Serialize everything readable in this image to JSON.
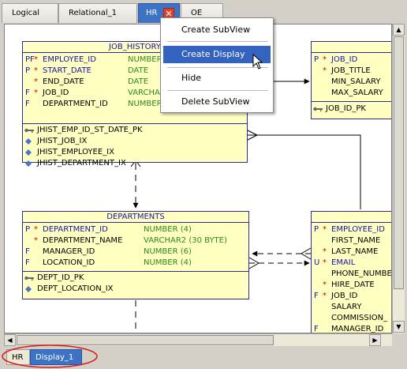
{
  "tabs": [
    {
      "label": "Logical"
    },
    {
      "label": "Relational_1"
    },
    {
      "label": "HR"
    },
    {
      "label": "OE"
    }
  ],
  "context_menu": {
    "items": [
      "Create SubView",
      "Create Display",
      "Hide",
      "Delete SubView"
    ],
    "selected": "Create Display"
  },
  "job_history": {
    "title": "JOB_HISTORY",
    "columns": [
      {
        "flag": "PF",
        "req": "*",
        "name": "EMPLOYEE_ID",
        "type": "NUMBER"
      },
      {
        "flag": "P",
        "req": "*",
        "name": "START_DATE",
        "type": "DATE"
      },
      {
        "flag": "",
        "req": "*",
        "name": "END_DATE",
        "type": "DATE"
      },
      {
        "flag": "F",
        "req": "*",
        "name": "JOB_ID",
        "type": "VARCHA"
      },
      {
        "flag": "F",
        "req": "",
        "name": "DEPARTMENT_ID",
        "type": "NUMBER"
      }
    ],
    "indexes": [
      "JHIST_EMP_ID_ST_DATE_PK",
      "JHIST_JOB_IX",
      "JHIST_EMPLOYEE_IX",
      "JHIST_DEPARTMENT_IX"
    ]
  },
  "jobs": {
    "columns": [
      {
        "flag": "P",
        "req": "*",
        "name": "JOB_ID"
      },
      {
        "flag": "",
        "req": "*",
        "name": "JOB_TITLE"
      },
      {
        "flag": "",
        "req": "",
        "name": "MIN_SALARY"
      },
      {
        "flag": "",
        "req": "",
        "name": "MAX_SALARY"
      }
    ],
    "indexes": [
      "JOB_ID_PK"
    ]
  },
  "departments": {
    "title": "DEPARTMENTS",
    "columns": [
      {
        "flag": "P",
        "req": "*",
        "name": "DEPARTMENT_ID",
        "type": "NUMBER (4)"
      },
      {
        "flag": "",
        "req": "*",
        "name": "DEPARTMENT_NAME",
        "type": "VARCHAR2 (30 BYTE)"
      },
      {
        "flag": "F",
        "req": "",
        "name": "MANAGER_ID",
        "type": "NUMBER (6)"
      },
      {
        "flag": "F",
        "req": "",
        "name": "LOCATION_ID",
        "type": "NUMBER (4)"
      }
    ],
    "indexes": [
      "DEPT_ID_PK",
      "DEPT_LOCATION_IX"
    ]
  },
  "employees": {
    "columns": [
      {
        "flag": "P",
        "req": "*",
        "name": "EMPLOYEE_ID"
      },
      {
        "flag": "",
        "req": "",
        "name": "FIRST_NAME"
      },
      {
        "flag": "",
        "req": "*",
        "name": "LAST_NAME"
      },
      {
        "flag": "U",
        "req": "*",
        "name": "EMAIL"
      },
      {
        "flag": "",
        "req": "",
        "name": "PHONE_NUMBE"
      },
      {
        "flag": "",
        "req": "*",
        "name": "HIRE_DATE"
      },
      {
        "flag": "F",
        "req": "*",
        "name": "JOB_ID"
      },
      {
        "flag": "",
        "req": "",
        "name": "SALARY"
      },
      {
        "flag": "",
        "req": "",
        "name": "COMMISSION_"
      },
      {
        "flag": "F",
        "req": "",
        "name": "MANAGER_ID"
      }
    ]
  },
  "bottom_tabs": [
    {
      "label": "HR"
    },
    {
      "label": "Display_1"
    }
  ],
  "colors": {
    "entity_fill": "#ffffc2",
    "entity_border": "#2c2c8f",
    "menu_highlight": "#3463bf",
    "active_tab": "#3c73c5",
    "annotation_ellipse": "#dd1a1a"
  }
}
